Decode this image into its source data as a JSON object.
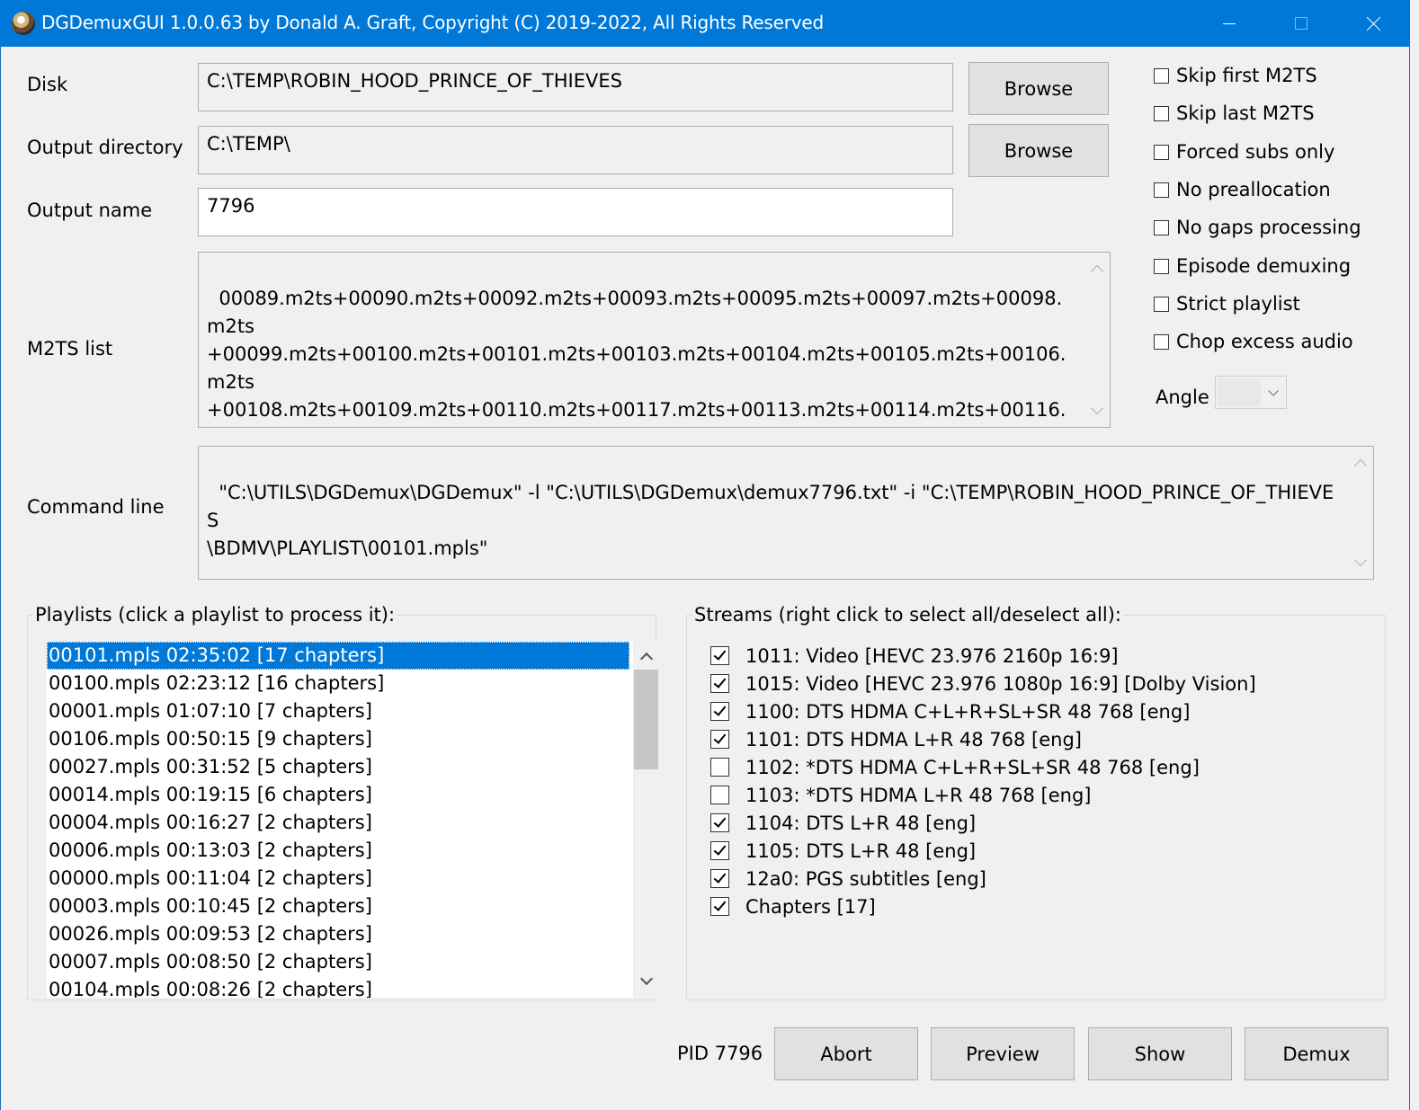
{
  "window": {
    "title": "DGDemuxGUI 1.0.0.63 by Donald A. Graft, Copyright (C) 2019-2022, All Rights Reserved"
  },
  "disk": {
    "label": "Disk",
    "value": "C:\\TEMP\\ROBIN_HOOD_PRINCE_OF_THIEVES",
    "browse_label": "Browse"
  },
  "output_directory": {
    "label": "Output directory",
    "value": "C:\\TEMP\\",
    "browse_label": "Browse"
  },
  "output_name": {
    "label": "Output name",
    "value": "7796"
  },
  "m2ts_list": {
    "label": "M2TS list",
    "value": "00089.m2ts+00090.m2ts+00092.m2ts+00093.m2ts+00095.m2ts+00097.m2ts+00098.m2ts\n+00099.m2ts+00100.m2ts+00101.m2ts+00103.m2ts+00104.m2ts+00105.m2ts+00106.m2ts\n+00108.m2ts+00109.m2ts+00110.m2ts+00117.m2ts+00113.m2ts+00114.m2ts+00116.m2ts"
  },
  "command_line": {
    "label": "Command line",
    "value": "\"C:\\UTILS\\DGDemux\\DGDemux\" -l \"C:\\UTILS\\DGDemux\\demux7796.txt\" -i \"C:\\TEMP\\ROBIN_HOOD_PRINCE_OF_THIEVES\n\\BDMV\\PLAYLIST\\00101.mpls\""
  },
  "options": [
    {
      "label": "Skip first M2TS",
      "checked": false
    },
    {
      "label": "Skip last M2TS",
      "checked": false
    },
    {
      "label": "Forced subs only",
      "checked": false
    },
    {
      "label": "No preallocation",
      "checked": false
    },
    {
      "label": "No gaps processing",
      "checked": false
    },
    {
      "label": "Episode demuxing",
      "checked": false
    },
    {
      "label": "Strict playlist",
      "checked": false
    },
    {
      "label": "Chop excess audio",
      "checked": false
    }
  ],
  "angle": {
    "label": "Angle",
    "value": ""
  },
  "playlists": {
    "title": "Playlists (click a playlist to process it):",
    "items": [
      "00101.mpls 02:35:02 [17 chapters]",
      "00100.mpls 02:23:12 [16 chapters]",
      "00001.mpls 01:07:10 [7 chapters]",
      "00106.mpls 00:50:15 [9 chapters]",
      "00027.mpls 00:31:52 [5 chapters]",
      "00014.mpls 00:19:15 [6 chapters]",
      "00004.mpls 00:16:27 [2 chapters]",
      "00006.mpls 00:13:03 [2 chapters]",
      "00000.mpls 00:11:04 [2 chapters]",
      "00003.mpls 00:10:45 [2 chapters]",
      "00026.mpls 00:09:53 [2 chapters]",
      "00007.mpls 00:08:50 [2 chapters]",
      "00104.mpls 00:08:26 [2 chapters]"
    ],
    "selected_index": 0
  },
  "streams": {
    "title": "Streams (right click to select all/deselect all):",
    "items": [
      {
        "label": "1011: Video [HEVC 23.976 2160p 16:9]",
        "checked": true
      },
      {
        "label": "1015: Video [HEVC 23.976 1080p 16:9] [Dolby Vision]",
        "checked": true
      },
      {
        "label": "1100: DTS HDMA C+L+R+SL+SR 48 768 [eng]",
        "checked": true
      },
      {
        "label": "1101: DTS HDMA L+R 48 768 [eng]",
        "checked": true
      },
      {
        "label": "1102: *DTS HDMA C+L+R+SL+SR 48 768 [eng]",
        "checked": false
      },
      {
        "label": "1103: *DTS HDMA L+R 48 768 [eng]",
        "checked": false
      },
      {
        "label": "1104: DTS L+R 48  [eng]",
        "checked": true
      },
      {
        "label": "1105: DTS L+R 48  [eng]",
        "checked": true
      },
      {
        "label": "12a0: PGS subtitles [eng]",
        "checked": true
      },
      {
        "label": "Chapters [17]",
        "checked": true
      }
    ]
  },
  "footer": {
    "pid": "PID 7796",
    "abort": "Abort",
    "preview": "Preview",
    "show": "Show",
    "demux": "Demux"
  }
}
